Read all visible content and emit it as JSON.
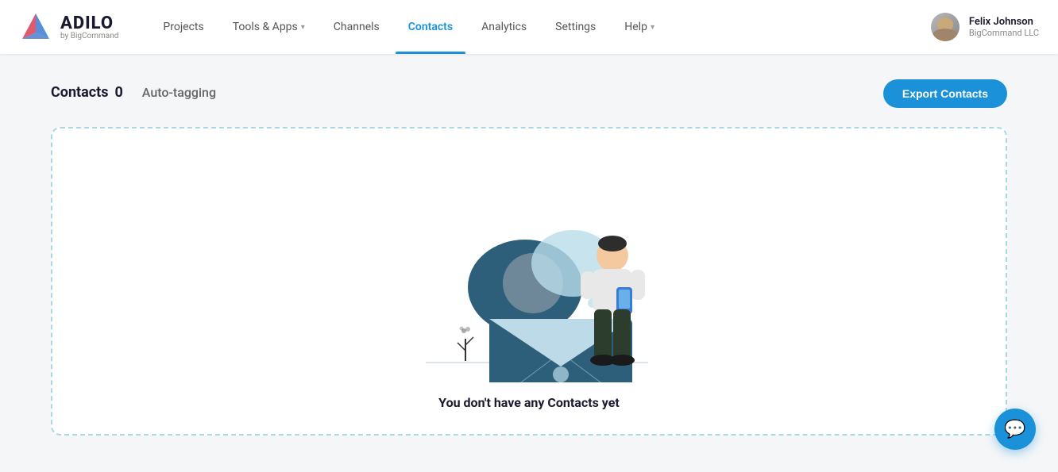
{
  "app": {
    "logo_main": "ADILO",
    "logo_sub": "by BigCommand"
  },
  "nav": {
    "links": [
      {
        "id": "projects",
        "label": "Projects",
        "has_dropdown": false,
        "active": false
      },
      {
        "id": "tools",
        "label": "Tools & Apps",
        "has_dropdown": true,
        "active": false
      },
      {
        "id": "channels",
        "label": "Channels",
        "has_dropdown": false,
        "active": false
      },
      {
        "id": "contacts",
        "label": "Contacts",
        "has_dropdown": false,
        "active": true
      },
      {
        "id": "analytics",
        "label": "Analytics",
        "has_dropdown": false,
        "active": false
      },
      {
        "id": "settings",
        "label": "Settings",
        "has_dropdown": false,
        "active": false
      },
      {
        "id": "help",
        "label": "Help",
        "has_dropdown": true,
        "active": false
      }
    ]
  },
  "user": {
    "name": "Felix Johnson",
    "company": "BigCommand LLC"
  },
  "page": {
    "tab_contacts_label": "Contacts",
    "tab_contacts_count": "0",
    "tab_autotagging_label": "Auto-tagging",
    "export_button_label": "Export Contacts",
    "empty_state_text": "You don't have any Contacts yet"
  }
}
